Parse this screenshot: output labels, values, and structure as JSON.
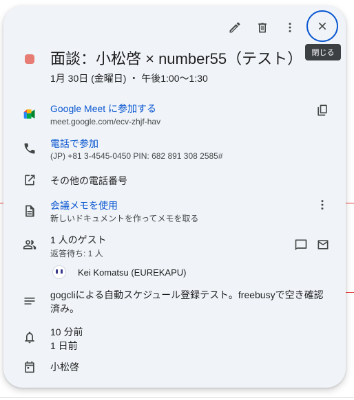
{
  "toolbar": {
    "edit_icon": "pencil-icon",
    "delete_icon": "trash-icon",
    "more_icon": "more-vert-icon",
    "close_icon": "close-icon",
    "close_tooltip": "閉じる"
  },
  "event": {
    "color": "#e67c73",
    "title": "面談：小松啓 × number55（テスト）",
    "datetime": "1月 30日 (金曜日) ・ 午後1:00～1:30"
  },
  "meet": {
    "link_label": "Google Meet に参加する",
    "url": "meet.google.com/ecv-zhjf-hav"
  },
  "phone": {
    "link_label": "電話で参加",
    "detail": "(JP) +81 3-4545-0450 PIN: 682 891 308 2585#"
  },
  "other_numbers": {
    "label": "その他の電話番号"
  },
  "notes": {
    "link_label": "会議メモを使用",
    "detail": "新しいドキュメントを作ってメモを取る"
  },
  "guests": {
    "count_label": "1 人のゲスト",
    "status": "返答待ち: 1 人",
    "list": [
      {
        "name": "Kei Komatsu (EUREKAPU)"
      }
    ]
  },
  "description": "gogcliによる自動スケジュール登録テスト。freebusyで空き確認済み。",
  "reminders": [
    "10 分前",
    "1 日前"
  ],
  "calendar_name": "小松啓"
}
